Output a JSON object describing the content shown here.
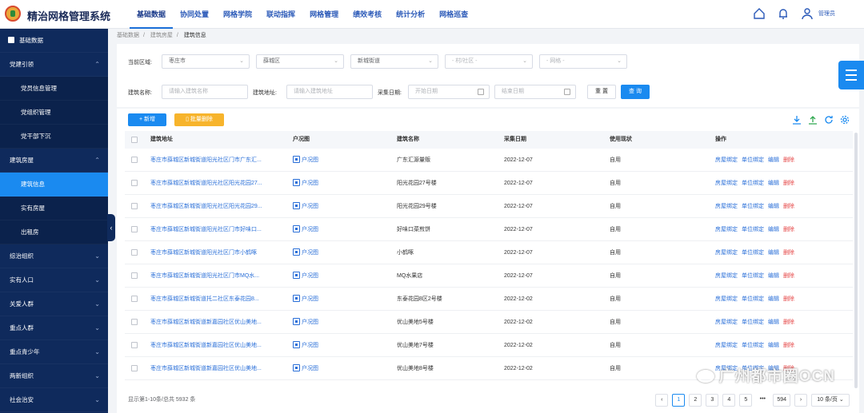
{
  "app": {
    "title": "精治网格管理系统"
  },
  "nav": [
    "基础数据",
    "协同处置",
    "网格学院",
    "联动指挥",
    "网格管理",
    "绩效考核",
    "统计分析",
    "网格巡查"
  ],
  "user": {
    "name": "管理员"
  },
  "sidebar": {
    "home": "基础数据",
    "items": [
      "党建引领",
      "党员信息管理",
      "党组织管理",
      "党干部下沉",
      "建筑房屋",
      "建筑信息",
      "实有房屋",
      "出租房",
      "综治组织",
      "实有人口",
      "关爱人群",
      "重点人群",
      "重点青少年",
      "两新组织",
      "社会治安"
    ]
  },
  "breadcrumb": [
    "基础数据",
    "建筑房屋",
    "建筑信息"
  ],
  "filters": {
    "area_label": "当前区域:",
    "city": "枣庄市",
    "district": "薛城区",
    "street": "新城街道",
    "village": "- 村/社区 -",
    "grid": "- 网格 -",
    "name_label": "建筑名称:",
    "name_ph": "请输入建筑名称",
    "addr_label": "建筑地址:",
    "addr_ph": "请输入建筑地址",
    "date_label": "采集日期:",
    "start_ph": "开始日期",
    "end_ph": "结束日期",
    "reset": "重 置",
    "search": "查 询"
  },
  "actions": {
    "add": "+ 新增",
    "batch_delete": "批量删除"
  },
  "table": {
    "headers": [
      "建筑地址",
      "户况图",
      "建筑名称",
      "采集日期",
      "使用现状",
      "操作"
    ],
    "rows": [
      {
        "addr": "枣庄市薛城区新城街道阳光社区门市广东汇...",
        "img": "户况图",
        "name": "广东汇源量贩",
        "date": "2022-12-07",
        "status": "自用"
      },
      {
        "addr": "枣庄市薛城区新城街道阳光社区阳光花园27...",
        "img": "户况图",
        "name": "阳光花园27号楼",
        "date": "2022-12-07",
        "status": "自用"
      },
      {
        "addr": "枣庄市薛城区新城街道阳光社区阳光花园29...",
        "img": "户况图",
        "name": "阳光花园29号楼",
        "date": "2022-12-07",
        "status": "自用"
      },
      {
        "addr": "枣庄市薛城区新城街道阳光社区门市好味口...",
        "img": "户况图",
        "name": "好味口菜煎饼",
        "date": "2022-12-07",
        "status": "自用"
      },
      {
        "addr": "枣庄市薛城区新城街道阳光社区门市小鹤啄",
        "img": "户况图",
        "name": "小鹤啄",
        "date": "2022-12-07",
        "status": "自用"
      },
      {
        "addr": "枣庄市薛城区新城街道阳光社区门市MQ水...",
        "img": "户况图",
        "name": "MQ水果店",
        "date": "2022-12-07",
        "status": "自用"
      },
      {
        "addr": "枣庄市薛城区新城街道托二社区东泰花园8...",
        "img": "户况图",
        "name": "东泰花园8区2号楼",
        "date": "2022-12-02",
        "status": "自用"
      },
      {
        "addr": "枣庄市薛城区新城街道新嘉园社区优山美地...",
        "img": "户况图",
        "name": "优山美地5号楼",
        "date": "2022-12-02",
        "status": "自用"
      },
      {
        "addr": "枣庄市薛城区新城街道新嘉园社区优山美地...",
        "img": "户况图",
        "name": "优山美地7号楼",
        "date": "2022-12-02",
        "status": "自用"
      },
      {
        "addr": "枣庄市薛城区新城街道新嘉园社区优山美地...",
        "img": "户况图",
        "name": "优山美地8号楼",
        "date": "2022-12-02",
        "status": "自用"
      }
    ],
    "ops": [
      "房屋绑定",
      "单位绑定",
      "编辑",
      "删除"
    ]
  },
  "pager": {
    "total": "显示第1-10条/总共 5932 条",
    "pages": [
      "1",
      "2",
      "3",
      "4",
      "5",
      "•••",
      "594"
    ],
    "size": "10 条/页"
  },
  "watermark": "广州都市圈OCN",
  "colors": {
    "accent": "#1a8af0",
    "sidebar": "#0f2a5c",
    "warn": "#f7b42c",
    "danger": "#e54545"
  }
}
